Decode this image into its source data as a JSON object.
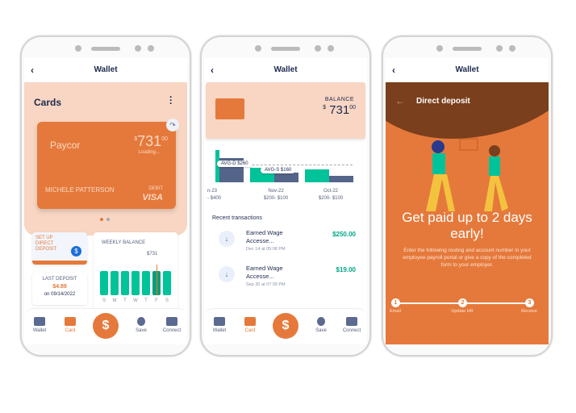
{
  "header_title": "Wallet",
  "nav": {
    "wallet": "Wallet",
    "card": "Card",
    "pay": "$",
    "save": "Save",
    "connect": "Connect"
  },
  "colors": {
    "accent": "#e5793b",
    "teal": "#00c39a",
    "navy": "#1d2a4d",
    "peach": "#f8d6c3",
    "brown": "#7a3f1c"
  },
  "screen1": {
    "title": "Cards",
    "card": {
      "brand": "Paycor",
      "amount": "731",
      "cents": "00",
      "currency": "$",
      "status": "Loading...",
      "holder": "MICHELE PATTERSON",
      "type": "DEBIT",
      "network": "VISA"
    },
    "setup": "SET UP DIRECT DEPOSIT",
    "last_deposit": {
      "label": "LAST DEPOSIT",
      "amount": "$4.89",
      "date": "on 09/14/2022"
    },
    "weekly": {
      "title": "WEEKLY BALANCE",
      "value": "$731",
      "days": [
        "S",
        "M",
        "T",
        "W",
        "T",
        "F",
        "S"
      ],
      "selected_day": 5
    }
  },
  "screen2": {
    "balance_label": "BALANCE",
    "currency": "$",
    "amount": "731",
    "cents": "00",
    "chart": {
      "avg_d": "AVG-D $260",
      "avg_s": "AVG-S $160",
      "months": [
        {
          "label": "n-23",
          "range": "- $400"
        },
        {
          "label": "Nov-22",
          "range": "$200- $100"
        },
        {
          "label": "Oct-22",
          "range": "$200- $100"
        }
      ]
    },
    "recent_title": "Recent transactions",
    "transactions": [
      {
        "name": "Earned Wage Accesse...",
        "date": "Dec 14 at 05:08 PM",
        "amount": "$250.00"
      },
      {
        "name": "Earned Wage Accesse...",
        "date": "Sep 30 at 07:39 PM",
        "amount": "$19.00"
      }
    ]
  },
  "screen3": {
    "title": "Direct deposit",
    "headline": "Get paid up to 2 days early!",
    "body": "Enter the following routing and account number in your employee payroll portal or give a copy of the completed form to your employer.",
    "steps": [
      {
        "n": "1",
        "label": "Email"
      },
      {
        "n": "2",
        "label": "Update HR"
      },
      {
        "n": "3",
        "label": "Receive"
      }
    ]
  }
}
